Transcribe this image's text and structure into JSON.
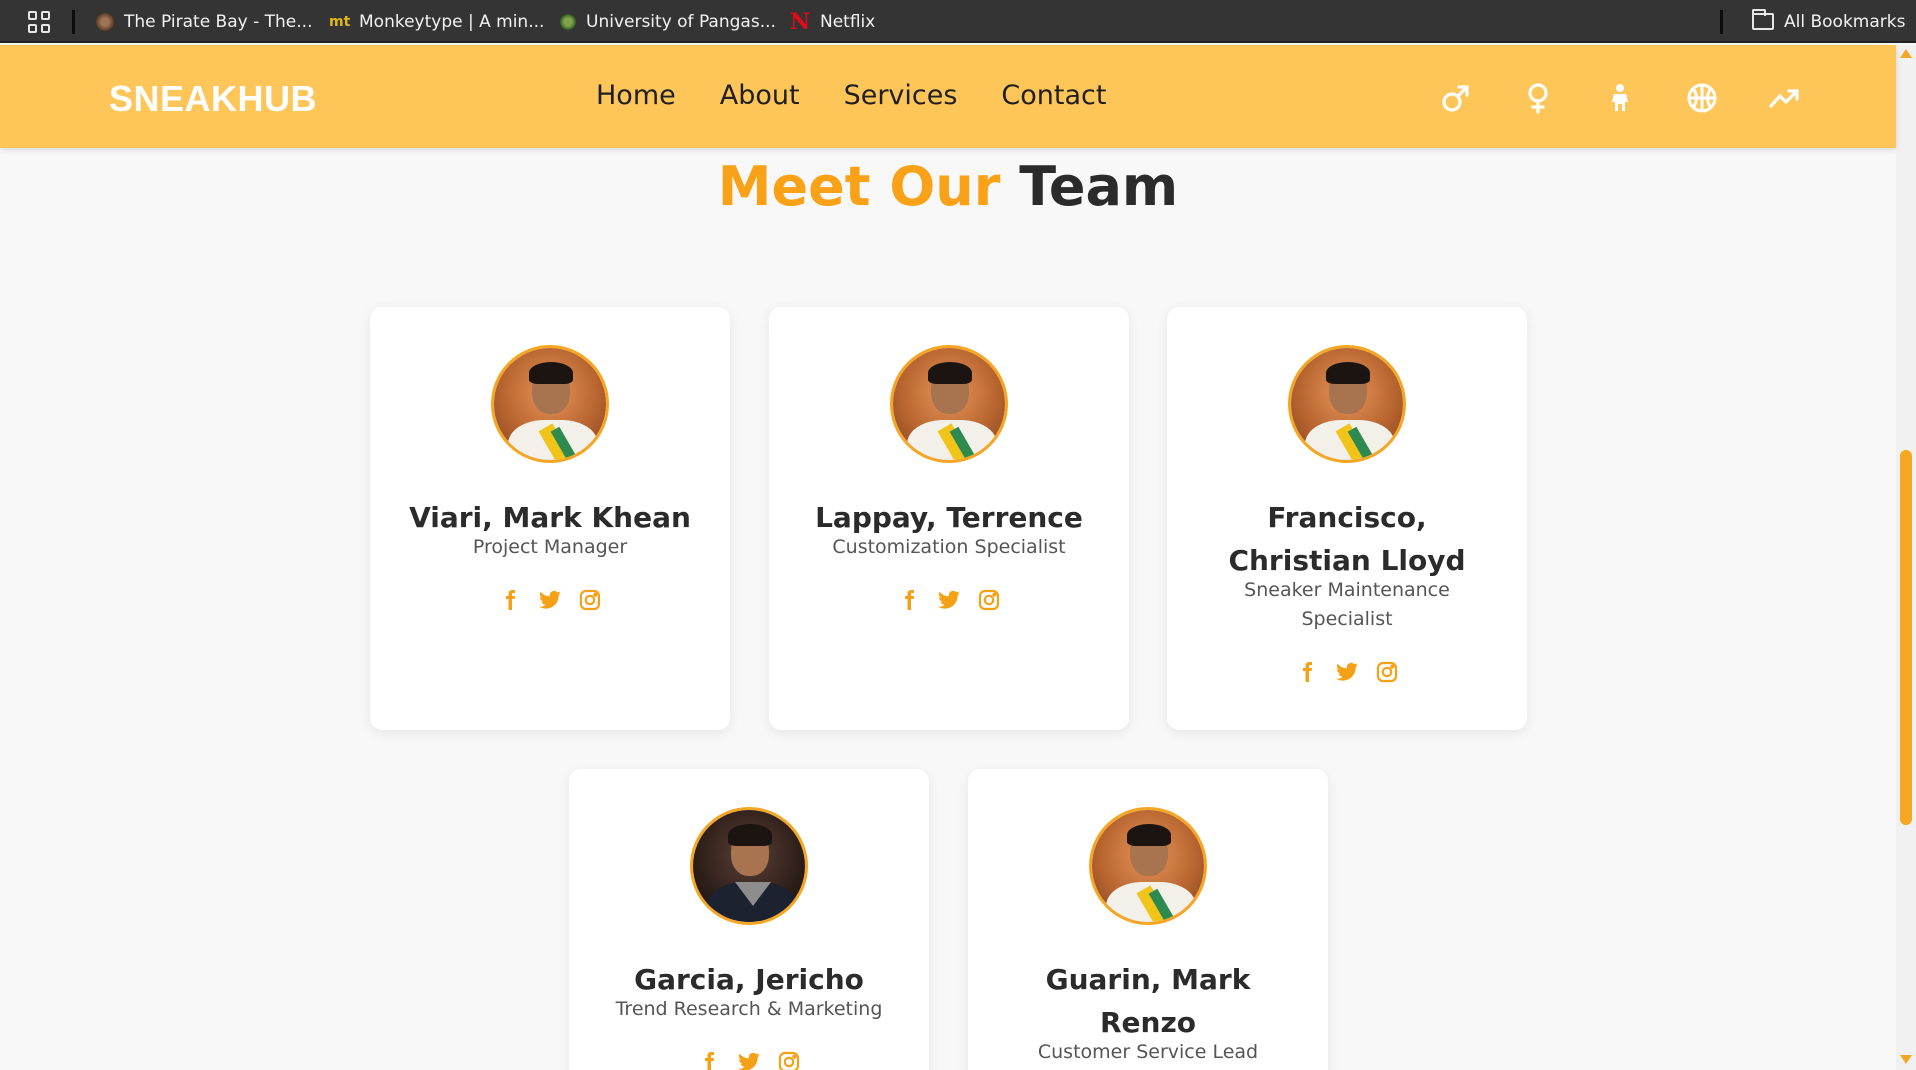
{
  "browser": {
    "bookmarks": [
      {
        "label": "The Pirate Bay - The...",
        "icon": "pirate-favicon"
      },
      {
        "label": "Monkeytype | A min...",
        "icon": "monkeytype-favicon",
        "icon_text": "mt"
      },
      {
        "label": "University of Pangas...",
        "icon": "university-favicon"
      },
      {
        "label": "Netflix",
        "icon": "netflix-favicon",
        "icon_text": "N"
      }
    ],
    "all_bookmarks": "All Bookmarks"
  },
  "header": {
    "logo": "SNEAKHUB",
    "nav": [
      "Home",
      "About",
      "Services",
      "Contact"
    ],
    "icons": [
      "male-icon",
      "female-icon",
      "child-icon",
      "basketball-icon",
      "trending-icon"
    ]
  },
  "team": {
    "title_accent": "Meet Our",
    "title_rest": "Team",
    "members": [
      {
        "name": "Viari, Mark Khean",
        "role": "Project Manager"
      },
      {
        "name": "Lappay, Terrence",
        "role": "Customization Specialist"
      },
      {
        "name": "Francisco, Christian Lloyd",
        "role": "Sneaker Maintenance Specialist"
      },
      {
        "name": "Garcia, Jericho",
        "role": "Trend Research & Marketing"
      },
      {
        "name": "Guarin, Mark Renzo",
        "role": "Customer Service Lead"
      }
    ],
    "social_icons": [
      "facebook-icon",
      "twitter-icon",
      "instagram-icon"
    ]
  },
  "colors": {
    "accent": "#f9a117",
    "header_bg": "#fec559",
    "text_dark": "#2b2b2b"
  }
}
